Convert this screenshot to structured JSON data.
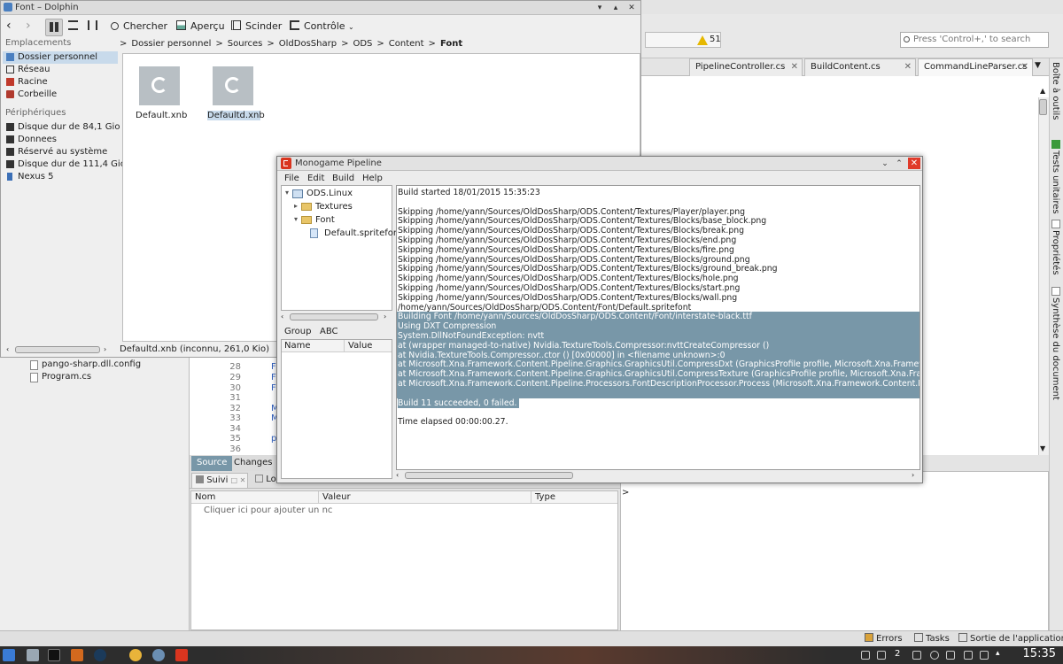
{
  "ide": {
    "warning_count": "51",
    "search_placeholder": "Press 'Control+,' to search",
    "tabs": [
      "PipelineController.cs",
      "BuildContent.cs",
      "CommandLineParser.cs"
    ],
    "right_panels": [
      "Boîte à outils",
      "Tests unitaires",
      "Propriétés",
      "Synthèse du document"
    ],
    "solution_files": [
      "pango-sharp.dll.config",
      "Program.cs"
    ],
    "line_numbers": [
      "28",
      "29",
      "30",
      "31",
      "32",
      "33",
      "34",
      "35",
      "36"
    ],
    "code_marks": [
      "F",
      "F",
      "F",
      "",
      "M",
      "M",
      "",
      "p",
      ""
    ],
    "source_tabs": [
      "Source",
      "Changes"
    ],
    "bottom_tabs": [
      "Suivi",
      "Lo"
    ],
    "tracking_columns": [
      "Nom",
      "Valeur",
      "Type"
    ],
    "tracking_hint": "Cliquer ici pour ajouter un nc",
    "output_prompt": ">",
    "status_items": [
      "Errors",
      "Tasks",
      "Sortie de l'application"
    ]
  },
  "dolphin": {
    "title": "Font – Dolphin",
    "toolbar": {
      "search": "Chercher",
      "preview": "Aperçu",
      "split": "Scinder",
      "control": "Contrôle"
    },
    "places_header": "Emplacements",
    "places": [
      "Dossier personnel",
      "Réseau",
      "Racine",
      "Corbeille"
    ],
    "devices_header": "Périphériques",
    "devices": [
      "Disque dur de 84,1 Gio",
      "Donnees",
      "Réservé au système",
      "Disque dur de 111,4 Gio",
      "Nexus 5"
    ],
    "breadcrumb": [
      "Dossier personnel",
      "Sources",
      "OldDosSharp",
      "ODS",
      "Content",
      "Font"
    ],
    "files": [
      "Default.xnb",
      "Defaultd.xnb"
    ],
    "status_text": "Defaultd.xnb (inconnu, 261,0 Kio)"
  },
  "pipeline": {
    "title": "Monogame Pipeline",
    "menu": [
      "File",
      "Edit",
      "Build",
      "Help"
    ],
    "tree": {
      "project": "ODS.Linux",
      "textures": "Textures",
      "font": "Font",
      "file": "Default.spritefont"
    },
    "prop_tabs": [
      "Group",
      "ABC"
    ],
    "prop_columns": [
      "Name",
      "Value"
    ],
    "log": [
      {
        "text": "Build started 18/01/2015 15:35:23",
        "style": ""
      },
      {
        "text": "",
        "style": ""
      },
      {
        "text": "Skipping /home/yann/Sources/OldDosSharp/ODS.Content/Textures/Player/player.png",
        "style": ""
      },
      {
        "text": "Skipping /home/yann/Sources/OldDosSharp/ODS.Content/Textures/Blocks/base_block.png",
        "style": ""
      },
      {
        "text": "Skipping /home/yann/Sources/OldDosSharp/ODS.Content/Textures/Blocks/break.png",
        "style": ""
      },
      {
        "text": "Skipping /home/yann/Sources/OldDosSharp/ODS.Content/Textures/Blocks/end.png",
        "style": ""
      },
      {
        "text": "Skipping /home/yann/Sources/OldDosSharp/ODS.Content/Textures/Blocks/fire.png",
        "style": ""
      },
      {
        "text": "Skipping /home/yann/Sources/OldDosSharp/ODS.Content/Textures/Blocks/ground.png",
        "style": ""
      },
      {
        "text": "Skipping /home/yann/Sources/OldDosSharp/ODS.Content/Textures/Blocks/ground_break.png",
        "style": ""
      },
      {
        "text": "Skipping /home/yann/Sources/OldDosSharp/ODS.Content/Textures/Blocks/hole.png",
        "style": ""
      },
      {
        "text": "Skipping /home/yann/Sources/OldDosSharp/ODS.Content/Textures/Blocks/start.png",
        "style": ""
      },
      {
        "text": "Skipping /home/yann/Sources/OldDosSharp/ODS.Content/Textures/Blocks/wall.png",
        "style": ""
      },
      {
        "text": "/home/yann/Sources/OldDosSharp/ODS.Content/Font/Default.spritefont",
        "style": ""
      },
      {
        "text": "Building Font /home/yann/Sources/OldDosSharp/ODS.Content/Font/interstate-black.ttf",
        "style": "hl"
      },
      {
        "text": "Using DXT Compression",
        "style": "hl"
      },
      {
        "text": "System.DllNotFoundException: nvtt",
        "style": "hl"
      },
      {
        "text": "  at (wrapper managed-to-native) Nvidia.TextureTools.Compressor:nvttCreateCompressor ()",
        "style": "hl"
      },
      {
        "text": "  at Nvidia.TextureTools.Compressor..ctor () [0x00000] in <filename unknown>:0",
        "style": "hl"
      },
      {
        "text": "  at Microsoft.Xna.Framework.Content.Pipeline.Graphics.GraphicsUtil.CompressDxt (GraphicsProfile profile, Microsoft.Xna.Framework",
        "style": "hl"
      },
      {
        "text": "  at Microsoft.Xna.Framework.Content.Pipeline.Graphics.GraphicsUtil.CompressTexture (GraphicsProfile profile, Microsoft.Xna.Framework",
        "style": "hl"
      },
      {
        "text": "  at Microsoft.Xna.Framework.Content.Pipeline.Processors.FontDescriptionProcessor.Process (Microsoft.Xna.Framework.Content.Pipeline",
        "style": "hl"
      },
      {
        "text": "",
        "style": "hl"
      },
      {
        "text": "Build 11 succeeded, 0 failed.",
        "style": "hlp"
      },
      {
        "text": "",
        "style": ""
      },
      {
        "text": "Time elapsed 00:00:00.27.",
        "style": ""
      }
    ]
  },
  "taskbar": {
    "clock": "15:35",
    "desktop_number": "2"
  },
  "colors": {
    "selection": "#7897a8",
    "accent_red": "#e03a2a",
    "places_selected": "#c8daeb"
  }
}
